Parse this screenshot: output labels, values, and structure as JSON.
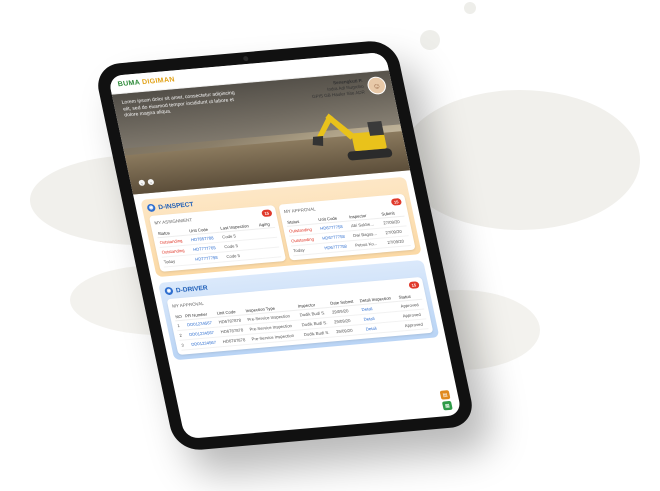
{
  "app": {
    "logo_main": "BUMA",
    "logo_accent": " DIGIMAN"
  },
  "hero": {
    "intro_text": "Lorem ipsum dolor sit amet, consectetur adipiscing elit, sed do eiusmod tempor incididunt ut labore et dolore magna aliqua.",
    "profile_name": "Senengkuti P.",
    "profile_role": "Indra Adi Nugroho",
    "profile_sub": "GPIS GB Hauler Site ADR",
    "slider_prev": "‹",
    "slider_next": "›"
  },
  "inspect": {
    "title": "D-INSPECT",
    "assignment": {
      "title": "MY ASSIGNMENT",
      "badge": "15",
      "columns": [
        "Status",
        "Unit Code",
        "Last Inspection",
        "Aging"
      ],
      "rows": [
        {
          "status": "Outstanding",
          "unit": "HD7857788",
          "code": "Code 5",
          "aging": ""
        },
        {
          "status": "Outstanding",
          "unit": "HD7777765",
          "code": "Code 5",
          "aging": ""
        },
        {
          "status": "Today",
          "unit": "HD7777798",
          "code": "Code 5",
          "aging": ""
        }
      ]
    },
    "approval": {
      "title": "MY APPROVAL",
      "badge": "15",
      "columns": [
        "Status",
        "Unit Code",
        "Inspector",
        "Submit"
      ],
      "rows": [
        {
          "status": "Outstanding",
          "unit": "HD6777758",
          "inspector": "Abi Sakhe...",
          "submit": "27/09/20"
        },
        {
          "status": "Outstanding",
          "unit": "HD6777758",
          "inspector": "Dwi Bagus...",
          "submit": "27/09/20"
        },
        {
          "status": "Today",
          "unit": "HD6777758",
          "inspector": "Petrus Ko...",
          "submit": "27/09/20"
        }
      ]
    }
  },
  "driver": {
    "title": "D-DRIVER",
    "approval": {
      "title": "MY APPROVAL",
      "badge": "15",
      "columns": [
        "NO",
        "PR Number",
        "Unit Code",
        "Inspection Type",
        "Inspector",
        "Date Submit",
        "Detail Inspection",
        "Status"
      ],
      "rows": [
        {
          "no": "1",
          "pr": "DD01234567",
          "unit": "HD6787878",
          "type": "Pre-Service Inspection",
          "inspector": "Dodik Budi S.",
          "date": "29/09/20",
          "detail": "Detail",
          "status": "Approved"
        },
        {
          "no": "2",
          "pr": "DD01234567",
          "unit": "HD6787878",
          "type": "Pre-Service Inspection",
          "inspector": "Dodik Budi S.",
          "date": "29/09/20",
          "detail": "Detail",
          "status": "Approved"
        },
        {
          "no": "3",
          "pr": "DD01234567",
          "unit": "HD6787878",
          "type": "Pre-Service Inspection",
          "inspector": "Dodik Budi S.",
          "date": "29/09/20",
          "detail": "Detail",
          "status": "Approved"
        }
      ]
    }
  },
  "colors": {
    "brand_green": "#2e8b3a",
    "brand_orange": "#e2a31a",
    "accent_blue": "#2f6fd0",
    "alert_red": "#e0392b"
  }
}
